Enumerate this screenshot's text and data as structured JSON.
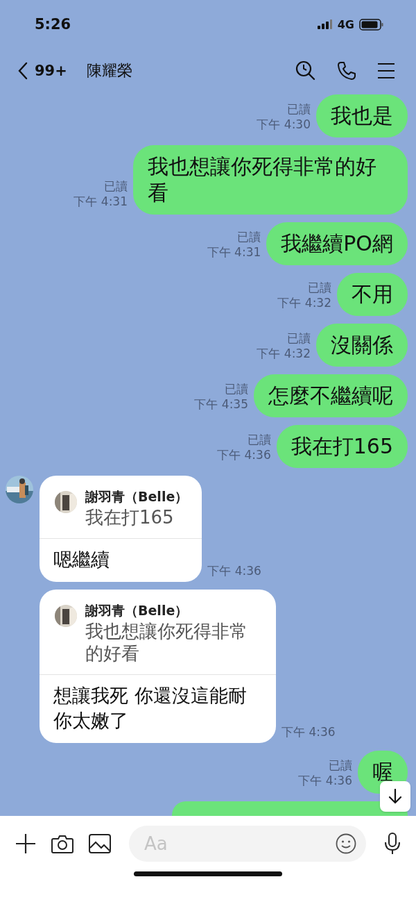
{
  "status_bar": {
    "time": "5:26",
    "network": "4G"
  },
  "header": {
    "back_badge": "99+",
    "title": "陳耀榮"
  },
  "messages": [
    {
      "kind": "sent",
      "read": "已讀",
      "time": "下午 4:30",
      "text": "我也是"
    },
    {
      "kind": "sent",
      "read": "已讀",
      "time": "下午 4:31",
      "text": "我也想讓你死得非常的好看"
    },
    {
      "kind": "sent",
      "read": "已讀",
      "time": "下午 4:31",
      "text": "我繼續PO網"
    },
    {
      "kind": "sent",
      "read": "已讀",
      "time": "下午 4:32",
      "text": "不用"
    },
    {
      "kind": "sent",
      "read": "已讀",
      "time": "下午 4:32",
      "text": "沒關係"
    },
    {
      "kind": "sent",
      "read": "已讀",
      "time": "下午 4:35",
      "text": "怎麼不繼續呢"
    },
    {
      "kind": "sent",
      "read": "已讀",
      "time": "下午 4:36",
      "text": "我在打165"
    },
    {
      "kind": "reply",
      "show_avatar": true,
      "quote_name": "謝羽青（Belle）",
      "quote_text": "我在打165",
      "text": "嗯繼續",
      "time": "下午 4:36"
    },
    {
      "kind": "reply",
      "show_avatar": false,
      "quote_name": "謝羽青（Belle）",
      "quote_text": "我也想讓你死得非常的好看",
      "text": "想讓我死 你還沒這能耐你太嫩了",
      "time": "下午 4:36"
    },
    {
      "kind": "sent",
      "read": "已讀",
      "time": "下午 4:36",
      "text": "喔"
    },
    {
      "kind": "partial"
    }
  ],
  "composer": {
    "placeholder": "Aa"
  }
}
